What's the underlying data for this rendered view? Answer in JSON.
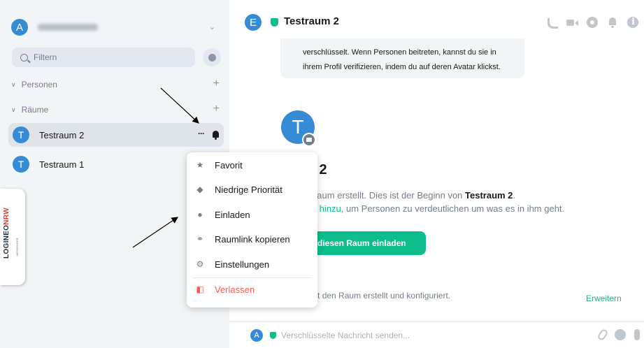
{
  "sidebar": {
    "user_avatar_letter": "A",
    "filter_placeholder": "Filtern",
    "sections": {
      "people": "Personen",
      "rooms": "Räume"
    },
    "rooms": [
      {
        "letter": "T",
        "name": "Testraum 2",
        "active": true
      },
      {
        "letter": "T",
        "name": "Testraum 1",
        "active": false
      }
    ],
    "brand": {
      "logineo": "LOGINEO",
      "nrw": "NRW",
      "sub": "MESSENGER"
    }
  },
  "room_header": {
    "avatar_letter": "E",
    "title": "Testraum 2",
    "icons": [
      "phone-icon",
      "video-icon",
      "threads-icon",
      "bell-icon",
      "info-icon"
    ]
  },
  "timeline": {
    "notice_line1": "verschlüsselt. Wenn Personen beitreten, kannst du sie in",
    "notice_line2": "ihrem Profil verifizieren, indem du auf deren Avatar klickst.",
    "room_avatar_letter": "T",
    "room_name_visible": "raum 2",
    "intro_line1_prefix": "diesen Raum erstellt. Dies ist der Beginn von ",
    "intro_line1_room": "Testraum 2",
    "intro_line1_suffix": ".",
    "intro_line2_link": "n Thema hinzu",
    "intro_line2_rest": ", um Personen zu verdeutlichen um was es in ihm geht.",
    "invite_button": "diesen Raum einladen",
    "event_text": "strnisa hat den Raum erstellt und konfiguriert.",
    "expand_label": "Erweitern"
  },
  "composer": {
    "avatar_letter": "A",
    "placeholder": "Verschlüsselte Nachricht senden..."
  },
  "context_menu": {
    "items": [
      {
        "label": "Favorit",
        "icon": "star-icon",
        "glyph": "★"
      },
      {
        "label": "Niedrige Priorität",
        "icon": "low-priority-icon",
        "glyph": "◆"
      },
      {
        "label": "Einladen",
        "icon": "invite-icon",
        "glyph": "●"
      },
      {
        "label": "Raumlink kopieren",
        "icon": "link-icon",
        "glyph": "⚭"
      },
      {
        "label": "Einstellungen",
        "icon": "gear-icon",
        "glyph": "⚙"
      },
      {
        "label": "Verlassen",
        "icon": "leave-icon",
        "glyph": "◧"
      }
    ]
  },
  "colors": {
    "accent_green": "#0dbd8b",
    "avatar_blue": "#368bd6",
    "danger_red": "#ff5b55",
    "sidebar_bg": "#f2f5f8"
  }
}
